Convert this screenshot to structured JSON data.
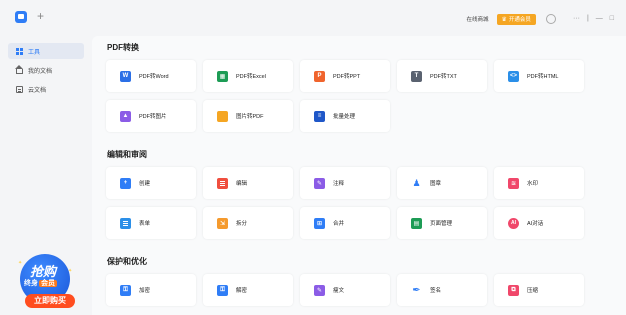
{
  "titlebar": {
    "right_text": "在线商城",
    "vip_label": "开通会员",
    "controls": [
      "···",
      "|",
      "—",
      "□"
    ]
  },
  "sidebar": {
    "items": [
      {
        "label": "工具",
        "icon": "grid-icon",
        "active": true
      },
      {
        "label": "我的文档",
        "icon": "home-icon",
        "active": false
      },
      {
        "label": "云文档",
        "icon": "cloud-doc-icon",
        "active": false
      }
    ]
  },
  "promo": {
    "big": "抢购",
    "mid": "终身",
    "mid_highlight": "会员",
    "buy": "立即购买"
  },
  "sections": [
    {
      "title": "PDF转换"
    },
    {
      "title": "编辑和审阅"
    },
    {
      "title": "保护和优化"
    }
  ],
  "tools": {
    "pdf_to_word": "PDF转Word",
    "pdf_to_excel": "PDF转Excel",
    "pdf_to_ppt": "PDF转PPT",
    "pdf_to_txt": "PDF转TXT",
    "pdf_to_html": "PDF转HTML",
    "pdf_to_image": "PDF转图片",
    "image_to_pdf": "图片转PDF",
    "batch": "批量处理",
    "create": "创建",
    "edit": "编辑",
    "annotate": "注释",
    "stamp": "图章",
    "watermark": "水印",
    "form": "表单",
    "split": "拆分",
    "merge": "合并",
    "page_manage": "页面管理",
    "ai_chat": "AI对话",
    "encrypt": "加密",
    "decrypt": "解密",
    "compress": "瘦文",
    "sign": "签名",
    "compare": "压缩"
  },
  "colors": {
    "accent": "#2f7df6",
    "vip": "#f5a623",
    "promo": "#1b56d8",
    "buy": "#ff4d1f"
  }
}
